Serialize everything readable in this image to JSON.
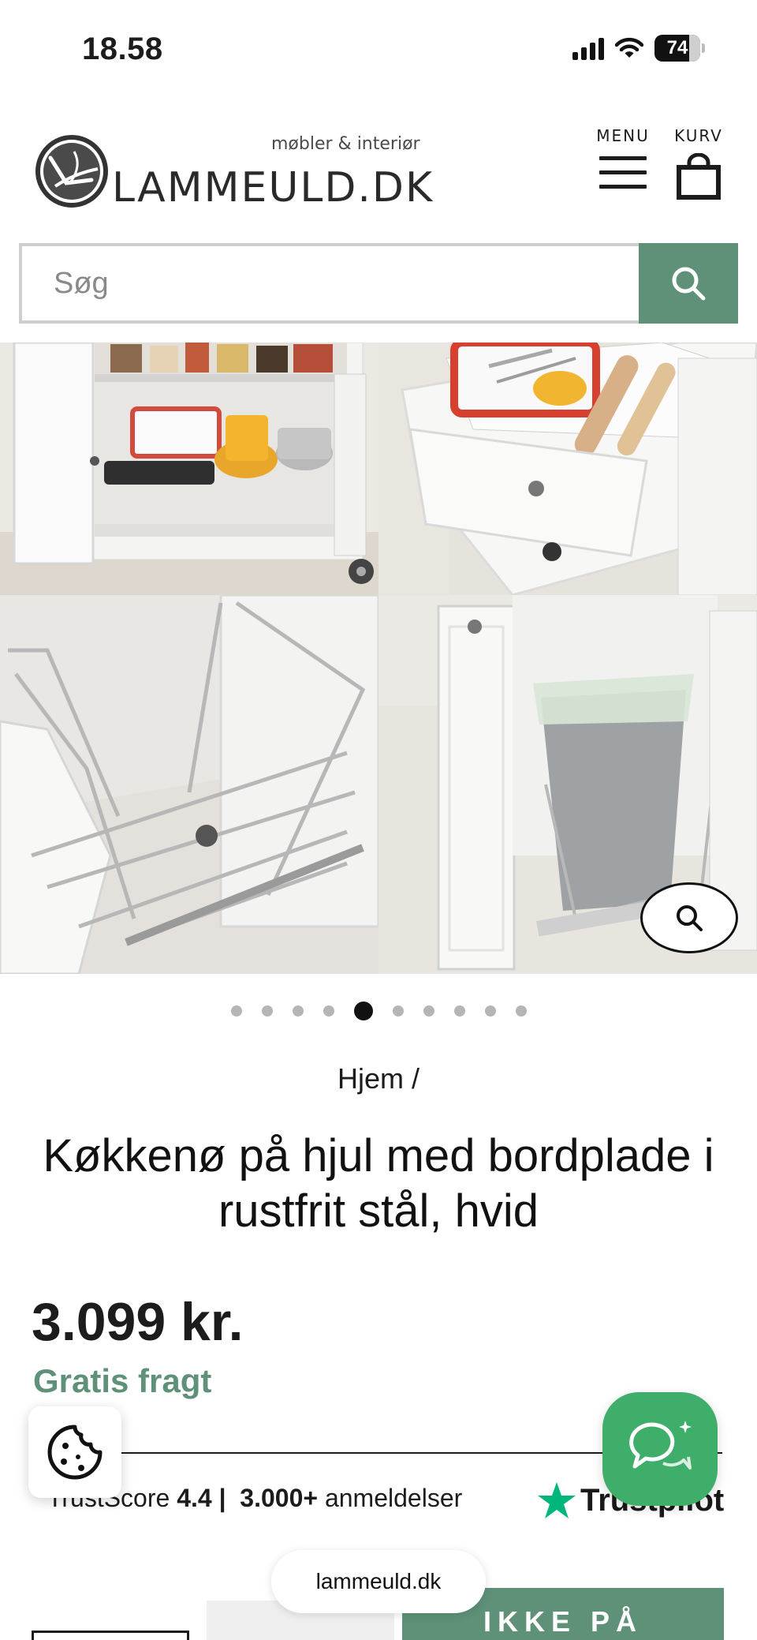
{
  "status_bar": {
    "time": "18.58",
    "battery": "74"
  },
  "header": {
    "logo_text": "LAMMEULD.DK",
    "tagline": "møbler & interiør",
    "menu_label": "MENU",
    "cart_label": "KURV"
  },
  "search": {
    "placeholder": "Søg"
  },
  "gallery": {
    "dot_count": 10,
    "active_dot": 5
  },
  "breadcrumb": "Hjem /",
  "product": {
    "title": "Køkkenø på hjul med bordplade i rustfrit stål, hvid",
    "price": "3.099 kr.",
    "shipping": "Gratis fragt"
  },
  "trustpilot": {
    "score_label": "TrustScore",
    "score": "4.4 |",
    "reviews_count": "3.000+",
    "reviews_label": "anmeldelser",
    "brand": "Trustpilot"
  },
  "actions": {
    "stock_button": "IKKE PÅ"
  },
  "browser": {
    "url": "lammeuld.dk"
  },
  "colors": {
    "accent": "#5e9178",
    "chat": "#3fae6a",
    "trustpilot_star": "#00b67a"
  }
}
